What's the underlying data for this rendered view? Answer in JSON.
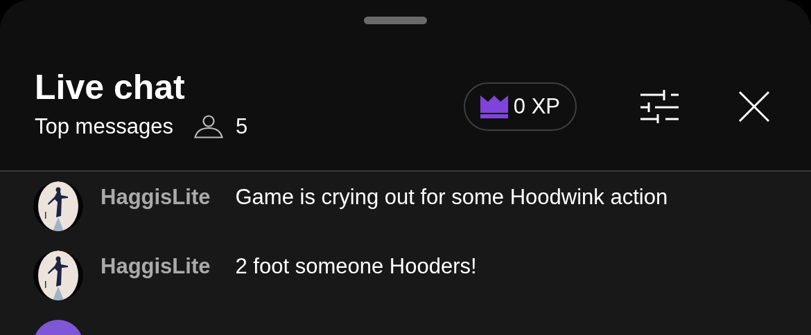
{
  "header": {
    "title": "Live chat",
    "mode": "Top messages",
    "viewers": "5",
    "xp": "0 XP"
  },
  "messages": [
    {
      "author": "HaggisLite",
      "text": "Game is crying out for some Hoodwink action"
    },
    {
      "author": "HaggisLite",
      "text": "2 foot someone Hooders!"
    },
    {
      "avatar": {
        "kind": "color",
        "color": "#7e57d6"
      }
    }
  ]
}
